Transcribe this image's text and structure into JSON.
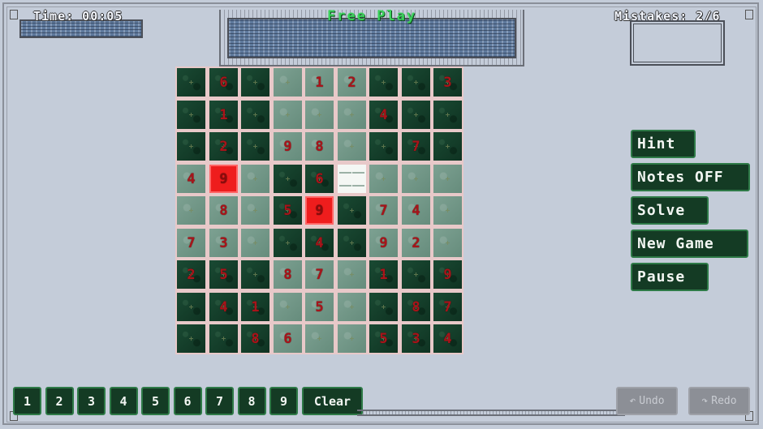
{
  "hud": {
    "time_label": "Time: 00:05",
    "title": "Free Play",
    "mistakes_label": "Mistakes: 2/6"
  },
  "board": {
    "rows": [
      [
        "",
        "6",
        "",
        "",
        "1",
        "2",
        "",
        "",
        "3"
      ],
      [
        "",
        "1",
        "",
        "",
        "",
        "",
        "4",
        "",
        ""
      ],
      [
        "",
        "2",
        "",
        "9",
        "8",
        "",
        "",
        "7",
        ""
      ],
      [
        "4",
        "9",
        "",
        "",
        "6",
        "",
        "",
        "",
        ""
      ],
      [
        "",
        "8",
        "",
        "5",
        "9",
        "",
        "7",
        "4",
        ""
      ],
      [
        "7",
        "3",
        "",
        "",
        "4",
        "",
        "9",
        "2",
        ""
      ],
      [
        "2",
        "5",
        "",
        "8",
        "7",
        "",
        "1",
        "",
        "9"
      ],
      [
        "",
        "4",
        "1",
        "",
        "5",
        "",
        "",
        "8",
        "7"
      ],
      [
        "",
        "",
        "8",
        "6",
        "",
        "",
        "5",
        "3",
        "4"
      ]
    ],
    "shade": [
      [
        "d",
        "d",
        "d",
        "l",
        "l",
        "l",
        "d",
        "d",
        "d"
      ],
      [
        "d",
        "d",
        "d",
        "l",
        "l",
        "l",
        "d",
        "d",
        "d"
      ],
      [
        "d",
        "d",
        "d",
        "l",
        "l",
        "l",
        "d",
        "d",
        "d"
      ],
      [
        "l",
        "r",
        "l",
        "d",
        "d",
        "w",
        "l",
        "l",
        "l"
      ],
      [
        "l",
        "l",
        "l",
        "d",
        "r",
        "d",
        "l",
        "l",
        "l"
      ],
      [
        "l",
        "l",
        "l",
        "d",
        "d",
        "d",
        "l",
        "l",
        "l"
      ],
      [
        "d",
        "d",
        "d",
        "l",
        "l",
        "l",
        "d",
        "d",
        "d"
      ],
      [
        "d",
        "d",
        "d",
        "l",
        "l",
        "l",
        "d",
        "d",
        "d"
      ],
      [
        "d",
        "d",
        "d",
        "l",
        "l",
        "l",
        "d",
        "d",
        "d"
      ]
    ]
  },
  "side_buttons": {
    "hint": "Hint",
    "notes": "Notes OFF",
    "solve": "Solve",
    "new_game": "New Game",
    "pause": "Pause"
  },
  "number_pad": [
    "1",
    "2",
    "3",
    "4",
    "5",
    "6",
    "7",
    "8",
    "9"
  ],
  "clear_label": "Clear",
  "undo_label": "Undo",
  "redo_label": "Redo",
  "colors": {
    "background": "#c4ccd9",
    "title": "#3bd15b",
    "digit": "#a8141a",
    "error_cell": "#ee1d1d",
    "button_bg": "#143b24",
    "button_border": "#2e7a47"
  }
}
